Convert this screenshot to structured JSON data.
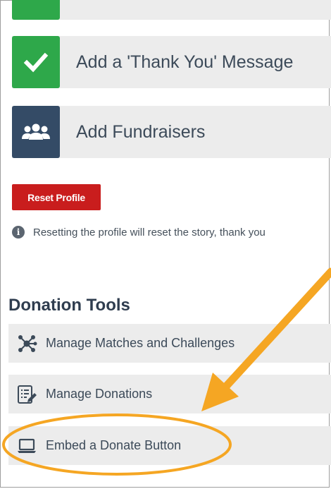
{
  "steps": [
    {
      "label": "Add a 'Thank You' Message",
      "icon": "check-icon",
      "color": "#2ea84a"
    },
    {
      "label": "Add Fundraisers",
      "icon": "users-icon",
      "color": "#344b66"
    }
  ],
  "reset": {
    "button_label": "Reset Profile",
    "info_text": "Resetting the profile will reset the story, thank you"
  },
  "donation_tools": {
    "title": "Donation Tools",
    "items": [
      {
        "label": "Manage Matches and Challenges",
        "icon": "network-icon"
      },
      {
        "label": "Manage Donations",
        "icon": "list-edit-icon"
      },
      {
        "label": "Embed a Donate Button",
        "icon": "laptop-icon"
      }
    ]
  },
  "annotation": {
    "color": "#f5a623",
    "arrow_icon": "arrow-icon",
    "highlight": "Embed a Donate Button"
  }
}
